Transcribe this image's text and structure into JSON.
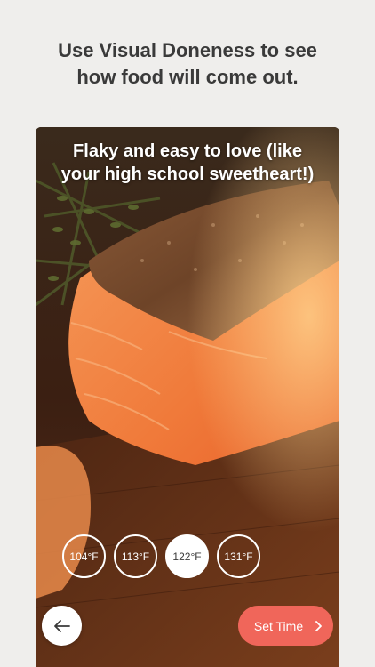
{
  "headline": "Use Visual Doneness to see\nhow food will come out.",
  "card": {
    "caption": "Flaky and easy to love (like\nyour high school sweetheart!)",
    "temperatures": [
      {
        "label": "104°F",
        "selected": false
      },
      {
        "label": "113°F",
        "selected": false
      },
      {
        "label": "122°F",
        "selected": true
      },
      {
        "label": "131°F",
        "selected": false
      }
    ],
    "back_icon": "arrow-left-icon",
    "set_time_label": "Set Time",
    "set_time_icon": "chevron-right-icon"
  },
  "colors": {
    "background": "#efeeec",
    "headline_text": "#3a3a3a",
    "accent": "#f0665a",
    "white": "#ffffff"
  }
}
